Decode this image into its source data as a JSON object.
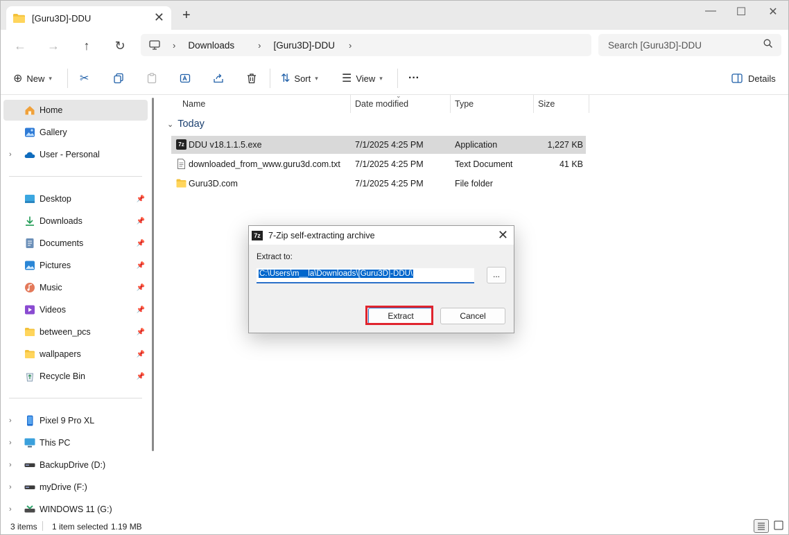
{
  "window": {
    "tab_title": "[Guru3D]-DDU",
    "new_tab": "+",
    "close_tab": "✕",
    "minimize": "—",
    "maximize": "☐",
    "close": "✕"
  },
  "nav": {
    "breadcrumb": [
      "Downloads",
      "[Guru3D]-DDU"
    ],
    "search_placeholder": "Search [Guru3D]-DDU"
  },
  "toolbar": {
    "new_label": "New",
    "sort_label": "Sort",
    "view_label": "View",
    "more_label": "···",
    "details_label": "Details"
  },
  "sidebar": {
    "items": [
      {
        "label": "Home"
      },
      {
        "label": "Gallery"
      },
      {
        "label": "User - Personal"
      },
      {
        "label": "Desktop"
      },
      {
        "label": "Downloads"
      },
      {
        "label": "Documents"
      },
      {
        "label": "Pictures"
      },
      {
        "label": "Music"
      },
      {
        "label": "Videos"
      },
      {
        "label": "between_pcs"
      },
      {
        "label": "wallpapers"
      },
      {
        "label": "Recycle Bin"
      },
      {
        "label": "Pixel 9 Pro XL"
      },
      {
        "label": "This PC"
      },
      {
        "label": "BackupDrive (D:)"
      },
      {
        "label": "myDrive (F:)"
      },
      {
        "label": "WINDOWS 11 (G:)"
      }
    ]
  },
  "content": {
    "columns": [
      "Name",
      "Date modified",
      "Type",
      "Size"
    ],
    "group": "Today",
    "rows": [
      {
        "name": "DDU v18.1.1.5.exe",
        "date": "7/1/2025 4:25 PM",
        "type": "Application",
        "size": "1,227 KB"
      },
      {
        "name": "downloaded_from_www.guru3d.com.txt",
        "date": "7/1/2025 4:25 PM",
        "type": "Text Document",
        "size": "41 KB"
      },
      {
        "name": "Guru3D.com",
        "date": "7/1/2025 4:25 PM",
        "type": "File folder",
        "size": ""
      }
    ]
  },
  "status": {
    "count": "3 items",
    "selected": "1 item selected",
    "size": "1.19 MB"
  },
  "dialog": {
    "title": "7-Zip self-extracting archive",
    "icon_text": "7z",
    "label": "Extract to:",
    "path": "C:\\Users\\m__la\\Downloads\\[Guru3D]-DDU\\",
    "browse": "...",
    "extract": "Extract",
    "cancel": "Cancel"
  },
  "colors": {
    "accent": "#2a6fc9",
    "highlight_box": "#e0242d",
    "selection": "#d9d9d9"
  }
}
